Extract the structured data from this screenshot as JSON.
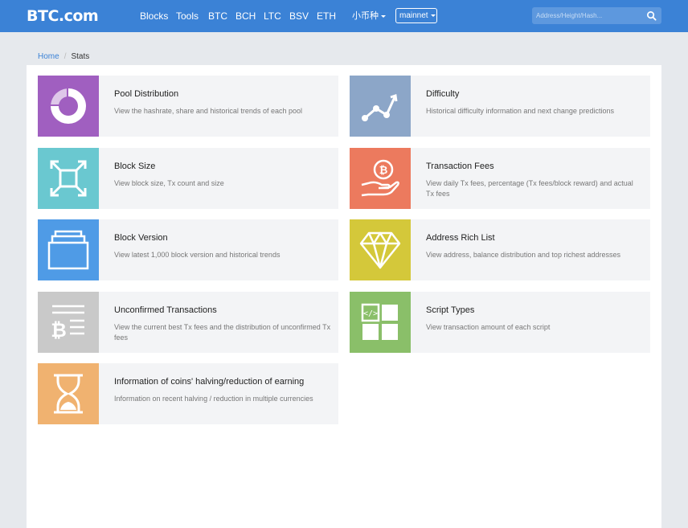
{
  "header": {
    "logo": "BTC.com",
    "nav": [
      "Blocks",
      "Tools",
      "BTC",
      "BCH",
      "LTC",
      "BSV",
      "ETH"
    ],
    "coin_menu": "小币种",
    "network": "mainnet",
    "search_placeholder": "Address/Height/Hash..."
  },
  "breadcrumb": {
    "home": "Home",
    "current": "Stats"
  },
  "cards": [
    {
      "title": "Pool Distribution",
      "desc": "View the hashrate,  share and historical trends of each pool",
      "color": "#a05fc0",
      "icon": "pie-chart-icon"
    },
    {
      "title": "Difficulty",
      "desc": "Historical difficulty information and next change predictions",
      "color": "#8ca6c8",
      "icon": "trend-line-icon"
    },
    {
      "title": "Block Size",
      "desc": "View block size,  Tx count and size",
      "color": "#6ac8d0",
      "icon": "expand-arrows-icon"
    },
    {
      "title": "Transaction Fees",
      "desc": "View daily Tx fees,  percentage (Tx fees/block reward) and actual Tx fees",
      "color": "#ec7a5e",
      "icon": "bitcoin-hand-icon"
    },
    {
      "title": "Block Version",
      "desc": "View latest 1,000 block version and historical trends",
      "color": "#4f9be6",
      "icon": "stacked-blocks-icon"
    },
    {
      "title": "Address Rich List",
      "desc": "View address,  balance distribution and top richest addresses",
      "color": "#d4c83a",
      "icon": "diamond-icon"
    },
    {
      "title": "Unconfirmed Transactions",
      "desc": "View the current best Tx fees and the distribution of unconfirmed Tx fees",
      "color": "#c9c9c9",
      "icon": "bitcoin-list-icon"
    },
    {
      "title": "Script Types",
      "desc": "View transaction amount of each script",
      "color": "#8abf69",
      "icon": "code-grid-icon"
    },
    {
      "title": "Information of coins' halving/reduction of earning",
      "desc": "Information on recent halving / reduction in multiple currencies",
      "color": "#f0b270",
      "icon": "hourglass-icon"
    }
  ]
}
